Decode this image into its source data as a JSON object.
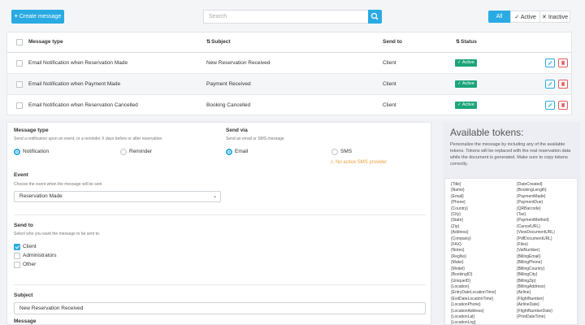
{
  "toolbar": {
    "create_label": "Create message",
    "search_placeholder": "Search",
    "filters": [
      "All",
      "Active",
      "Inactive"
    ]
  },
  "table": {
    "headers": [
      "Message type",
      "Subject",
      "Send to",
      "Status"
    ],
    "rows": [
      {
        "type": "Email Notification when Reservation Made",
        "subject": "New Reservation Received",
        "send_to": "Client",
        "status": "Active"
      },
      {
        "type": "Email Notification when Payment Made",
        "subject": "Payment Received",
        "send_to": "Client",
        "status": "Active"
      },
      {
        "type": "Email Notification when Reservation Cancelled",
        "subject": "Booking Cancelled",
        "send_to": "Client",
        "status": "Active"
      }
    ]
  },
  "form": {
    "message_type_label": "Message type",
    "message_type_hint": "Send a notification upon an event, or a reminder X days before or after reservation",
    "message_type_options": [
      "Notification",
      "Reminder"
    ],
    "send_via_label": "Send via",
    "send_via_hint": "Send an email or SMS message",
    "send_via_options": [
      "Email",
      "SMS"
    ],
    "sms_warning": "No active SMS provider",
    "event_label": "Event",
    "event_hint": "Choose the event when the message will be sent",
    "event_value": "Reservation Made",
    "send_to_label": "Send to",
    "send_to_hint": "Select who you want the message to be sent to.",
    "send_to_options": [
      "Client",
      "Administrators",
      "Other"
    ],
    "subject_label": "Subject",
    "subject_value": "New Reservation Received",
    "message_label": "Message"
  },
  "tokens": {
    "title": "Available tokens:",
    "description": "Personalize the message by including any of the available tokens. Tokens will be replaced with the real reservation data while the document is generated. Make sure to copy tokens correctly.",
    "col1": [
      "{Title}",
      "{Name}",
      "{Email}",
      "{Phone}",
      "{Country}",
      "{City}",
      "{State}",
      "{Zip}",
      "{Address}",
      "{Company}",
      "{FAX}",
      "{Notes}",
      "{RegNo}",
      "{Make}",
      "{Model}",
      "{BookingID}",
      "{UniqueID}",
      "{Location}",
      "{EntryDateLocationTime}",
      "{ExitDateLocationTime}",
      "{LocationPhone}",
      "{LocationAddress}",
      "{LocationLat}",
      "{LocationLng}"
    ],
    "col2": [
      "{DateCreated}",
      "{BookingLength}",
      "{PaymentMade}",
      "{PaymentDue}",
      "{QRBarcode}",
      "{Tax}",
      "{PaymentMethod}",
      "{CancelURL}",
      "{ViewDocumentURL}",
      "{PdfDocumentURL}",
      "{Files}",
      "{VatNumber}",
      "{BillingEmail}",
      "{BillingPhone}",
      "{BillingCountry}",
      "{BillingCity}",
      "{BillingZip}",
      "{BillingAddress}",
      "{Airline}",
      "{FlightNumber}",
      "{AirlineDate}",
      "{FlightNumberDate}",
      "{PrintDateTime}"
    ]
  }
}
